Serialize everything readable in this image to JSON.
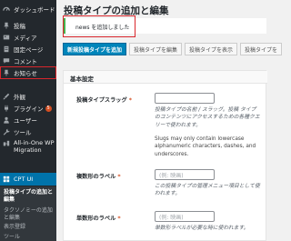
{
  "sidebar": {
    "items": [
      {
        "label": "ダッシュボード",
        "icon": "dashboard-icon"
      },
      {
        "label": "投稿",
        "icon": "pin-icon"
      },
      {
        "label": "メディア",
        "icon": "media-icon"
      },
      {
        "label": "固定ページ",
        "icon": "page-icon"
      },
      {
        "label": "コメント",
        "icon": "comment-icon"
      },
      {
        "label": "お知らせ",
        "icon": "pin-icon"
      },
      {
        "label": "外観",
        "icon": "appearance-icon"
      },
      {
        "label": "プラグイン",
        "icon": "plugin-icon",
        "badge": "5"
      },
      {
        "label": "ユーザー",
        "icon": "users-icon"
      },
      {
        "label": "ツール",
        "icon": "tools-icon"
      },
      {
        "label": "All-in-One WP Migration",
        "icon": "migration-icon"
      },
      {
        "label": "CPT UI",
        "icon": "cpt-icon"
      }
    ],
    "submenu": [
      {
        "label": "投稿タイプの追加と編集",
        "active": true
      },
      {
        "label": "タクソノミーの追加と編集",
        "active": false
      },
      {
        "label": "表示登録",
        "active": false
      },
      {
        "label": "ツール",
        "active": false
      }
    ]
  },
  "main": {
    "page_title": "投稿タイプの追加と編集",
    "notice": "news を追加しました",
    "tabs": [
      "新規投稿タイプを追加",
      "投稿タイプを編集",
      "投稿タイプを表示",
      "投稿タイプを"
    ],
    "panel_title": "基本設定",
    "fields": {
      "slug": {
        "label": "投稿タイプスラッグ",
        "required": "*",
        "help": "投稿タイプの名前 / スラッグ。投稿 タイプのコンテンツにアクセスするための各種クエリーで使われます。",
        "note": "Slugs may only contain lowercase alphanumeric characters, dashes, and underscores."
      },
      "plural": {
        "label": "複数形のラベル",
        "required": "*",
        "placeholder": "(例: 映画)",
        "help": "この投稿タイプの管理メニュー項目として使われます。"
      },
      "singular": {
        "label": "単数形のラベル",
        "required": "*",
        "placeholder": "(例: 映画)",
        "help": "単数形ラベルが必要な時に使われます。"
      }
    }
  },
  "colors": {
    "sidebar_bg": "#23282d",
    "accent": "#0073aa",
    "primary_button": "#0085ba",
    "highlight_box": "#d9262c",
    "notice_border": "#46b450"
  }
}
